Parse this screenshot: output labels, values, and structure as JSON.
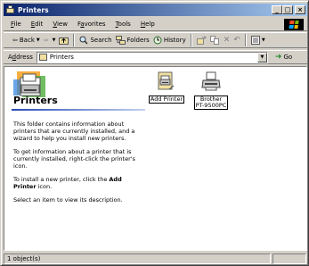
{
  "window": {
    "title": "Printers",
    "controls": {
      "minimize": "_",
      "maximize": "□",
      "close": "×"
    }
  },
  "menu": {
    "items": [
      {
        "label": "File",
        "accel": "F",
        "rest": "ile"
      },
      {
        "label": "Edit",
        "accel": "E",
        "rest": "dit"
      },
      {
        "label": "View",
        "accel": "V",
        "rest": "iew"
      },
      {
        "label": "Favorites",
        "pre": "F",
        "accel": "a",
        "rest": "vorites"
      },
      {
        "label": "Tools",
        "accel": "T",
        "rest": "ools"
      },
      {
        "label": "Help",
        "accel": "H",
        "rest": "elp"
      }
    ]
  },
  "toolbar": {
    "back": "Back",
    "search": "Search",
    "folders": "Folders",
    "history": "History"
  },
  "address": {
    "label_accel": "d",
    "label_pre": "A",
    "label_rest": "dress",
    "value": "Printers",
    "go": "Go"
  },
  "webview": {
    "title": "Printers",
    "para1": "This folder contains information about printers that are currently installed, and a wizard to help you install new printers.",
    "para2": "To get information about a printer that is currently installed, right-click the printer's icon.",
    "para3_pre": "To install a new printer, click the ",
    "para3_bold": "Add Printer",
    "para3_post": " icon.",
    "para4": "Select an item to view its description."
  },
  "icons": [
    {
      "name": "add-printer",
      "label": "Add Printer"
    },
    {
      "name": "brother-printer",
      "label_line1": "Brother",
      "label_line2": "PT-9500PC"
    }
  ],
  "status": {
    "text": "1 object(s)"
  },
  "colors": {
    "titlebar_start": "#0a246a",
    "titlebar_end": "#a6caf0",
    "chrome": "#d4d0c8"
  }
}
